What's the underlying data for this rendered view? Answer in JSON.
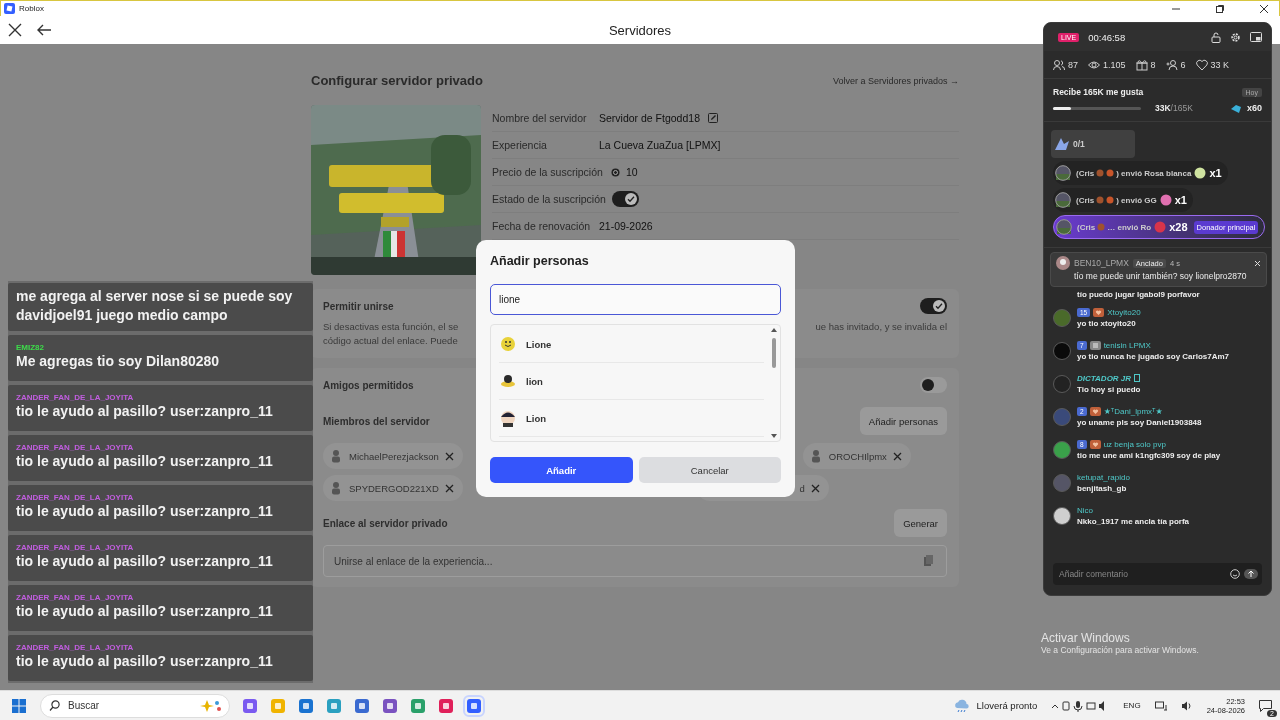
{
  "window": {
    "title": "Roblox"
  },
  "app_header": {
    "title": "Servidores"
  },
  "page": {
    "title": "Configurar servidor privado",
    "back_link": "Volver a Servidores privados →",
    "fields": [
      {
        "label": "Nombre del servidor",
        "value": "Servidor de Ftgodd18",
        "kind": "editable"
      },
      {
        "label": "Experiencia",
        "value": "La Cueva ZuaZua [LPMX]",
        "kind": "text"
      },
      {
        "label": "Precio de la suscripción",
        "value": "10",
        "kind": "price"
      },
      {
        "label": "Estado de la suscripción",
        "kind": "toggle",
        "on": true
      },
      {
        "label": "Fecha de renovación",
        "value": "21-09-2026",
        "kind": "text"
      }
    ],
    "allow_join": {
      "label": "Permitir unirse",
      "on": true,
      "description_left": [
        "Si desactivas esta función, el se",
        "código actual del enlace. Puede"
      ],
      "description_right": "ue has invitado, y se invalida el"
    },
    "friends": {
      "label": "Amigos permitidos",
      "on": false
    },
    "members": {
      "label": "Miembros del servidor",
      "add_button": "Añadir personas",
      "chips": [
        {
          "kind": "visible",
          "name": "MichaelPerezjackson"
        },
        {
          "kind": "visible",
          "name": "OROCHIlpmx"
        },
        {
          "kind": "visible",
          "name": "SPYDERGOD221XD"
        },
        {
          "kind": "cut",
          "name": "d"
        }
      ]
    },
    "link": {
      "label": "Enlace al servidor privado",
      "button": "Generar",
      "placeholder": "Unirse al enlace de la experiencia..."
    }
  },
  "dialog": {
    "title": "Añadir personas",
    "search_value": "lione",
    "results": [
      {
        "name": "Lione"
      },
      {
        "name": "lion"
      },
      {
        "name": "Lion"
      }
    ],
    "buttons": [
      {
        "label": "Añadir",
        "kind": "primary"
      },
      {
        "label": "Cancelar",
        "kind": "secondary"
      }
    ]
  },
  "chat_overlay": {
    "messages": [
      {
        "text": "me agrega al server nose si se puede soy davidjoel91 juego medio campo"
      },
      {
        "user": "EMIZ82",
        "color": "#3ddc4a",
        "text": "Me agregas tio soy Dilan80280"
      },
      {
        "user": "ZANDER_FAN_DE_LA_JOYITA",
        "color": "#c25ee0",
        "text": "tio le ayudo al pasillo? user:zanpro_11"
      },
      {
        "user": "ZANDER_FAN_DE_LA_JOYITA",
        "color": "#c25ee0",
        "text": "tio le ayudo al pasillo? user:zanpro_11"
      },
      {
        "user": "ZANDER_FAN_DE_LA_JOYITA",
        "color": "#c25ee0",
        "text": "tio le ayudo al pasillo? user:zanpro_11"
      },
      {
        "user": "ZANDER_FAN_DE_LA_JOYITA",
        "color": "#c25ee0",
        "text": "tio le ayudo al pasillo? user:zanpro_11"
      },
      {
        "user": "ZANDER_FAN_DE_LA_JOYITA",
        "color": "#c25ee0",
        "text": "tio le ayudo al pasillo? user:zanpro_11"
      },
      {
        "user": "ZANDER_FAN_DE_LA_JOYITA",
        "color": "#c25ee0",
        "text": "tio le ayudo al pasillo? user:zanpro_11"
      }
    ]
  },
  "live_panel": {
    "badge": "LIVE",
    "timer": "00:46:58",
    "stats": [
      {
        "kind": "viewers",
        "value": "87"
      },
      {
        "kind": "views",
        "value": "1.105"
      },
      {
        "kind": "gifts",
        "value": "8"
      },
      {
        "kind": "joins",
        "value": "6"
      },
      {
        "kind": "likes",
        "value": "33 K"
      }
    ],
    "goal": {
      "title": "Recibe 165K me gusta",
      "tag": "Hoy",
      "level": 0.2,
      "progress_current": "33K",
      "progress_total": "/165K",
      "reward": "x60"
    },
    "gift_counter": "0/1",
    "gifts": [
      {
        "kind": "normal",
        "sender": "(Cris",
        "action": ") envió Rosa blanca",
        "count": "x1"
      },
      {
        "kind": "normal",
        "sender": "(Cris",
        "action": ") envió GG",
        "count": "x1"
      },
      {
        "kind": "top",
        "sender": "(Cris",
        "action": "… envió Ro",
        "count": "x28",
        "badge": "Donador principal"
      }
    ],
    "pinned": {
      "user": "BEN10_LPMX",
      "tag": "Anclado",
      "time": "4 s",
      "text": "tío me puede unir también? soy lionelpro2870"
    },
    "comments": [
      {
        "kind": "continued",
        "text": "tío puedo jugar Igabol9 porfavor"
      },
      {
        "kind": "normal",
        "badges": [
          {
            "kind": "level",
            "label": "15"
          },
          {
            "kind": "fan"
          }
        ],
        "user": "Xtoyito20",
        "text": "yo tio xtoyito20"
      },
      {
        "kind": "normal",
        "badges": [
          {
            "kind": "level",
            "label": "7"
          },
          {
            "kind": "member"
          }
        ],
        "user": "tenisin LPMX",
        "text": "yo tio nunca he jugado soy Carlos7Am7"
      },
      {
        "kind": "stylized",
        "user": "DICTADOR JR",
        "text": "Tio hoy si puedo"
      },
      {
        "kind": "normal",
        "badges": [
          {
            "kind": "level",
            "label": "2"
          },
          {
            "kind": "fan"
          }
        ],
        "user": "★ᵀDani_lpmxᵀ★",
        "text": "yo uname pls soy Daniel1903848"
      },
      {
        "kind": "normal",
        "badges": [
          {
            "kind": "level",
            "label": "8"
          },
          {
            "kind": "fan"
          }
        ],
        "user": "uz benja solo pvp",
        "text": "tio me une ami k1ngfc309 soy de play"
      },
      {
        "kind": "normal",
        "user": "ketupat_rapido",
        "text": "benjitash_gb"
      },
      {
        "kind": "normal",
        "user": "Nico",
        "text": "Nkko_1917 me ancla tía porfa"
      }
    ],
    "comment_placeholder": "Añadir comentario"
  },
  "activation_notice": {
    "title": "Activar Windows",
    "text": "Ve a Configuración para activar Windows."
  },
  "taskbar": {
    "search_placeholder": "Buscar",
    "weather": "Lloverá pronto",
    "language": "ENG",
    "time": "22:53",
    "date": "24-08-2026",
    "notifications": "2"
  }
}
